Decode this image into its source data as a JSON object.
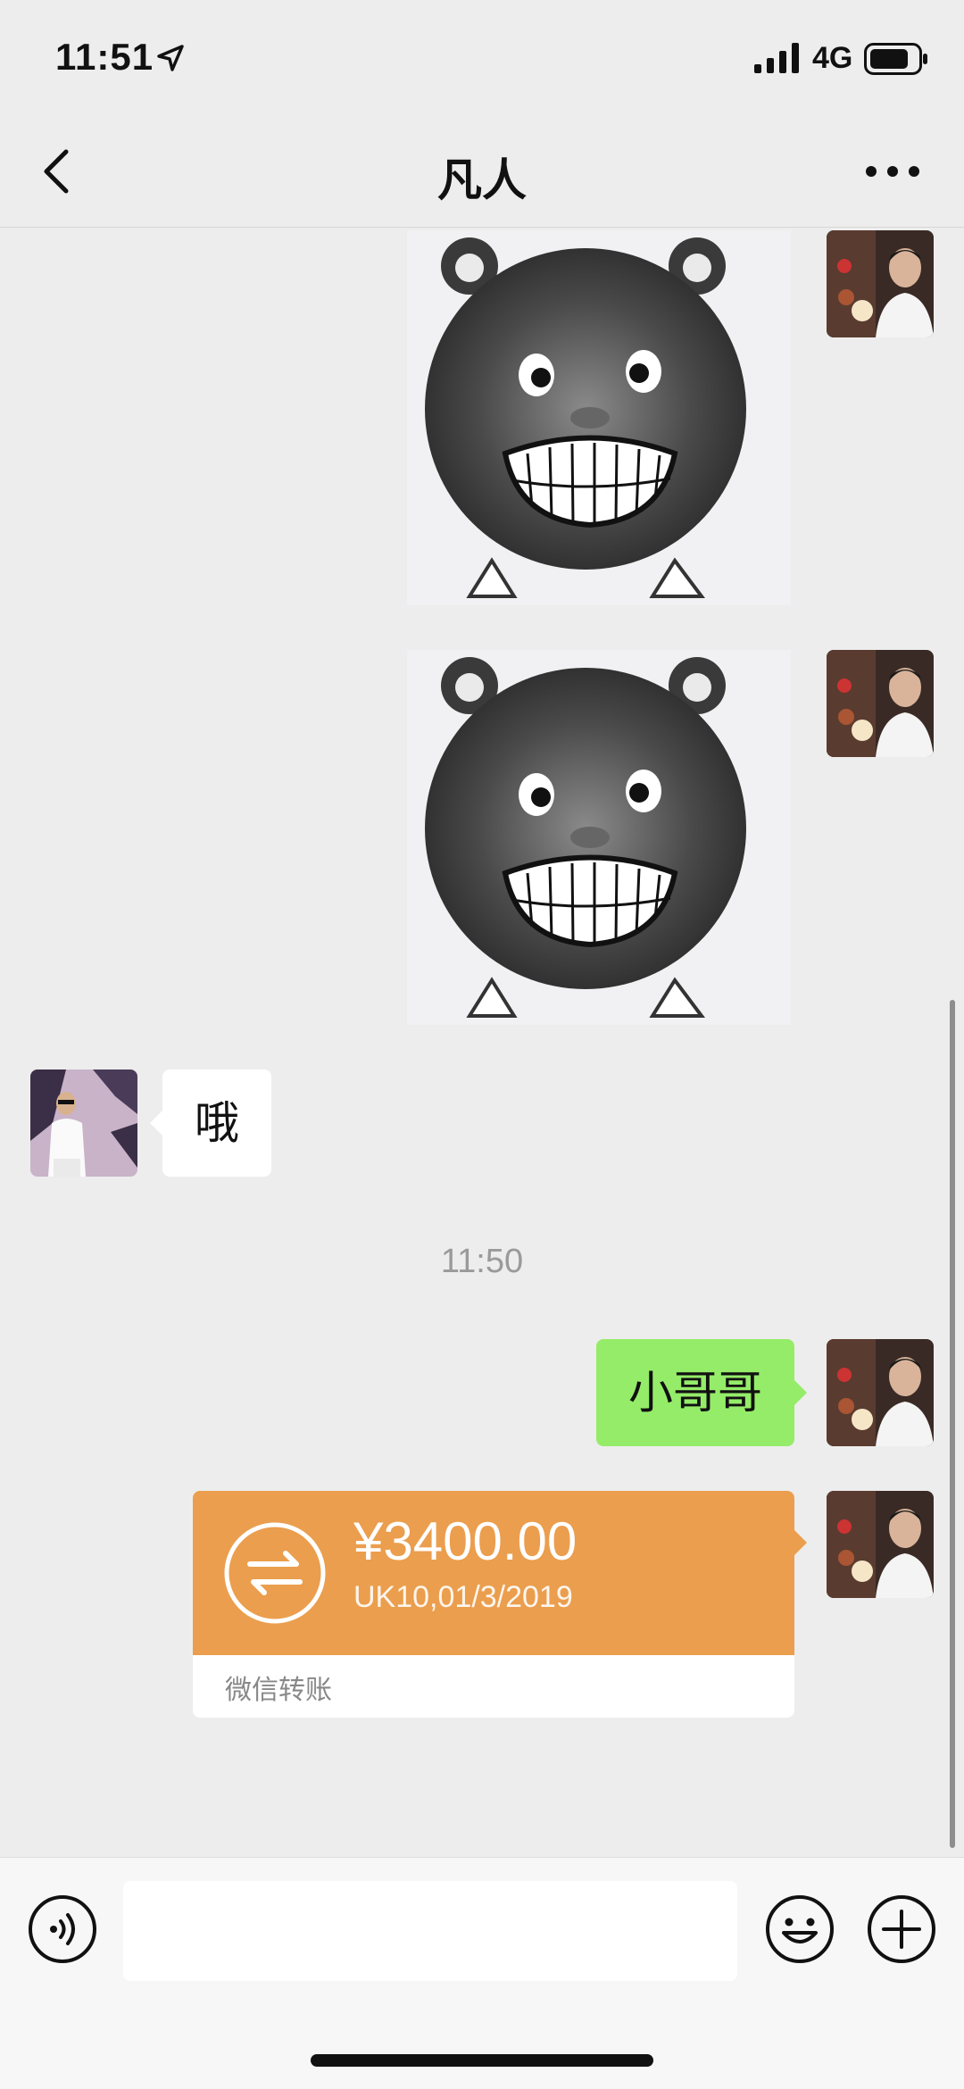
{
  "status_bar": {
    "time": "11:51",
    "location_icon": "location-arrow-icon",
    "signal_icon": "signal-bars-icon",
    "network": "4G",
    "battery_icon": "battery-icon"
  },
  "nav": {
    "title": "凡人",
    "back_icon": "chevron-left-icon",
    "more_icon": "more-dots-icon"
  },
  "messages": {
    "sticker_1": {
      "sender": "self",
      "type": "sticker",
      "icon": "grinning-pig-sticker"
    },
    "sticker_2": {
      "sender": "self",
      "type": "sticker",
      "icon": "grinning-pig-sticker"
    },
    "friend_text": {
      "sender": "friend",
      "type": "text",
      "text": "哦"
    },
    "timestamp": "11:50",
    "self_text": {
      "sender": "self",
      "type": "text",
      "text": "小哥哥"
    },
    "transfer": {
      "sender": "self",
      "amount": "¥3400.00",
      "note": "UK10,01/3/2019",
      "label": "微信转账",
      "icon": "transfer-arrows-icon"
    }
  },
  "input_bar": {
    "voice_icon": "voice-icon",
    "input_value": "",
    "emoji_icon": "emoji-icon",
    "plus_icon": "plus-circle-icon"
  },
  "colors": {
    "background": "#ededed",
    "self_bubble": "#95ec69",
    "friend_bubble": "#ffffff",
    "transfer": "#eb9e4d"
  }
}
